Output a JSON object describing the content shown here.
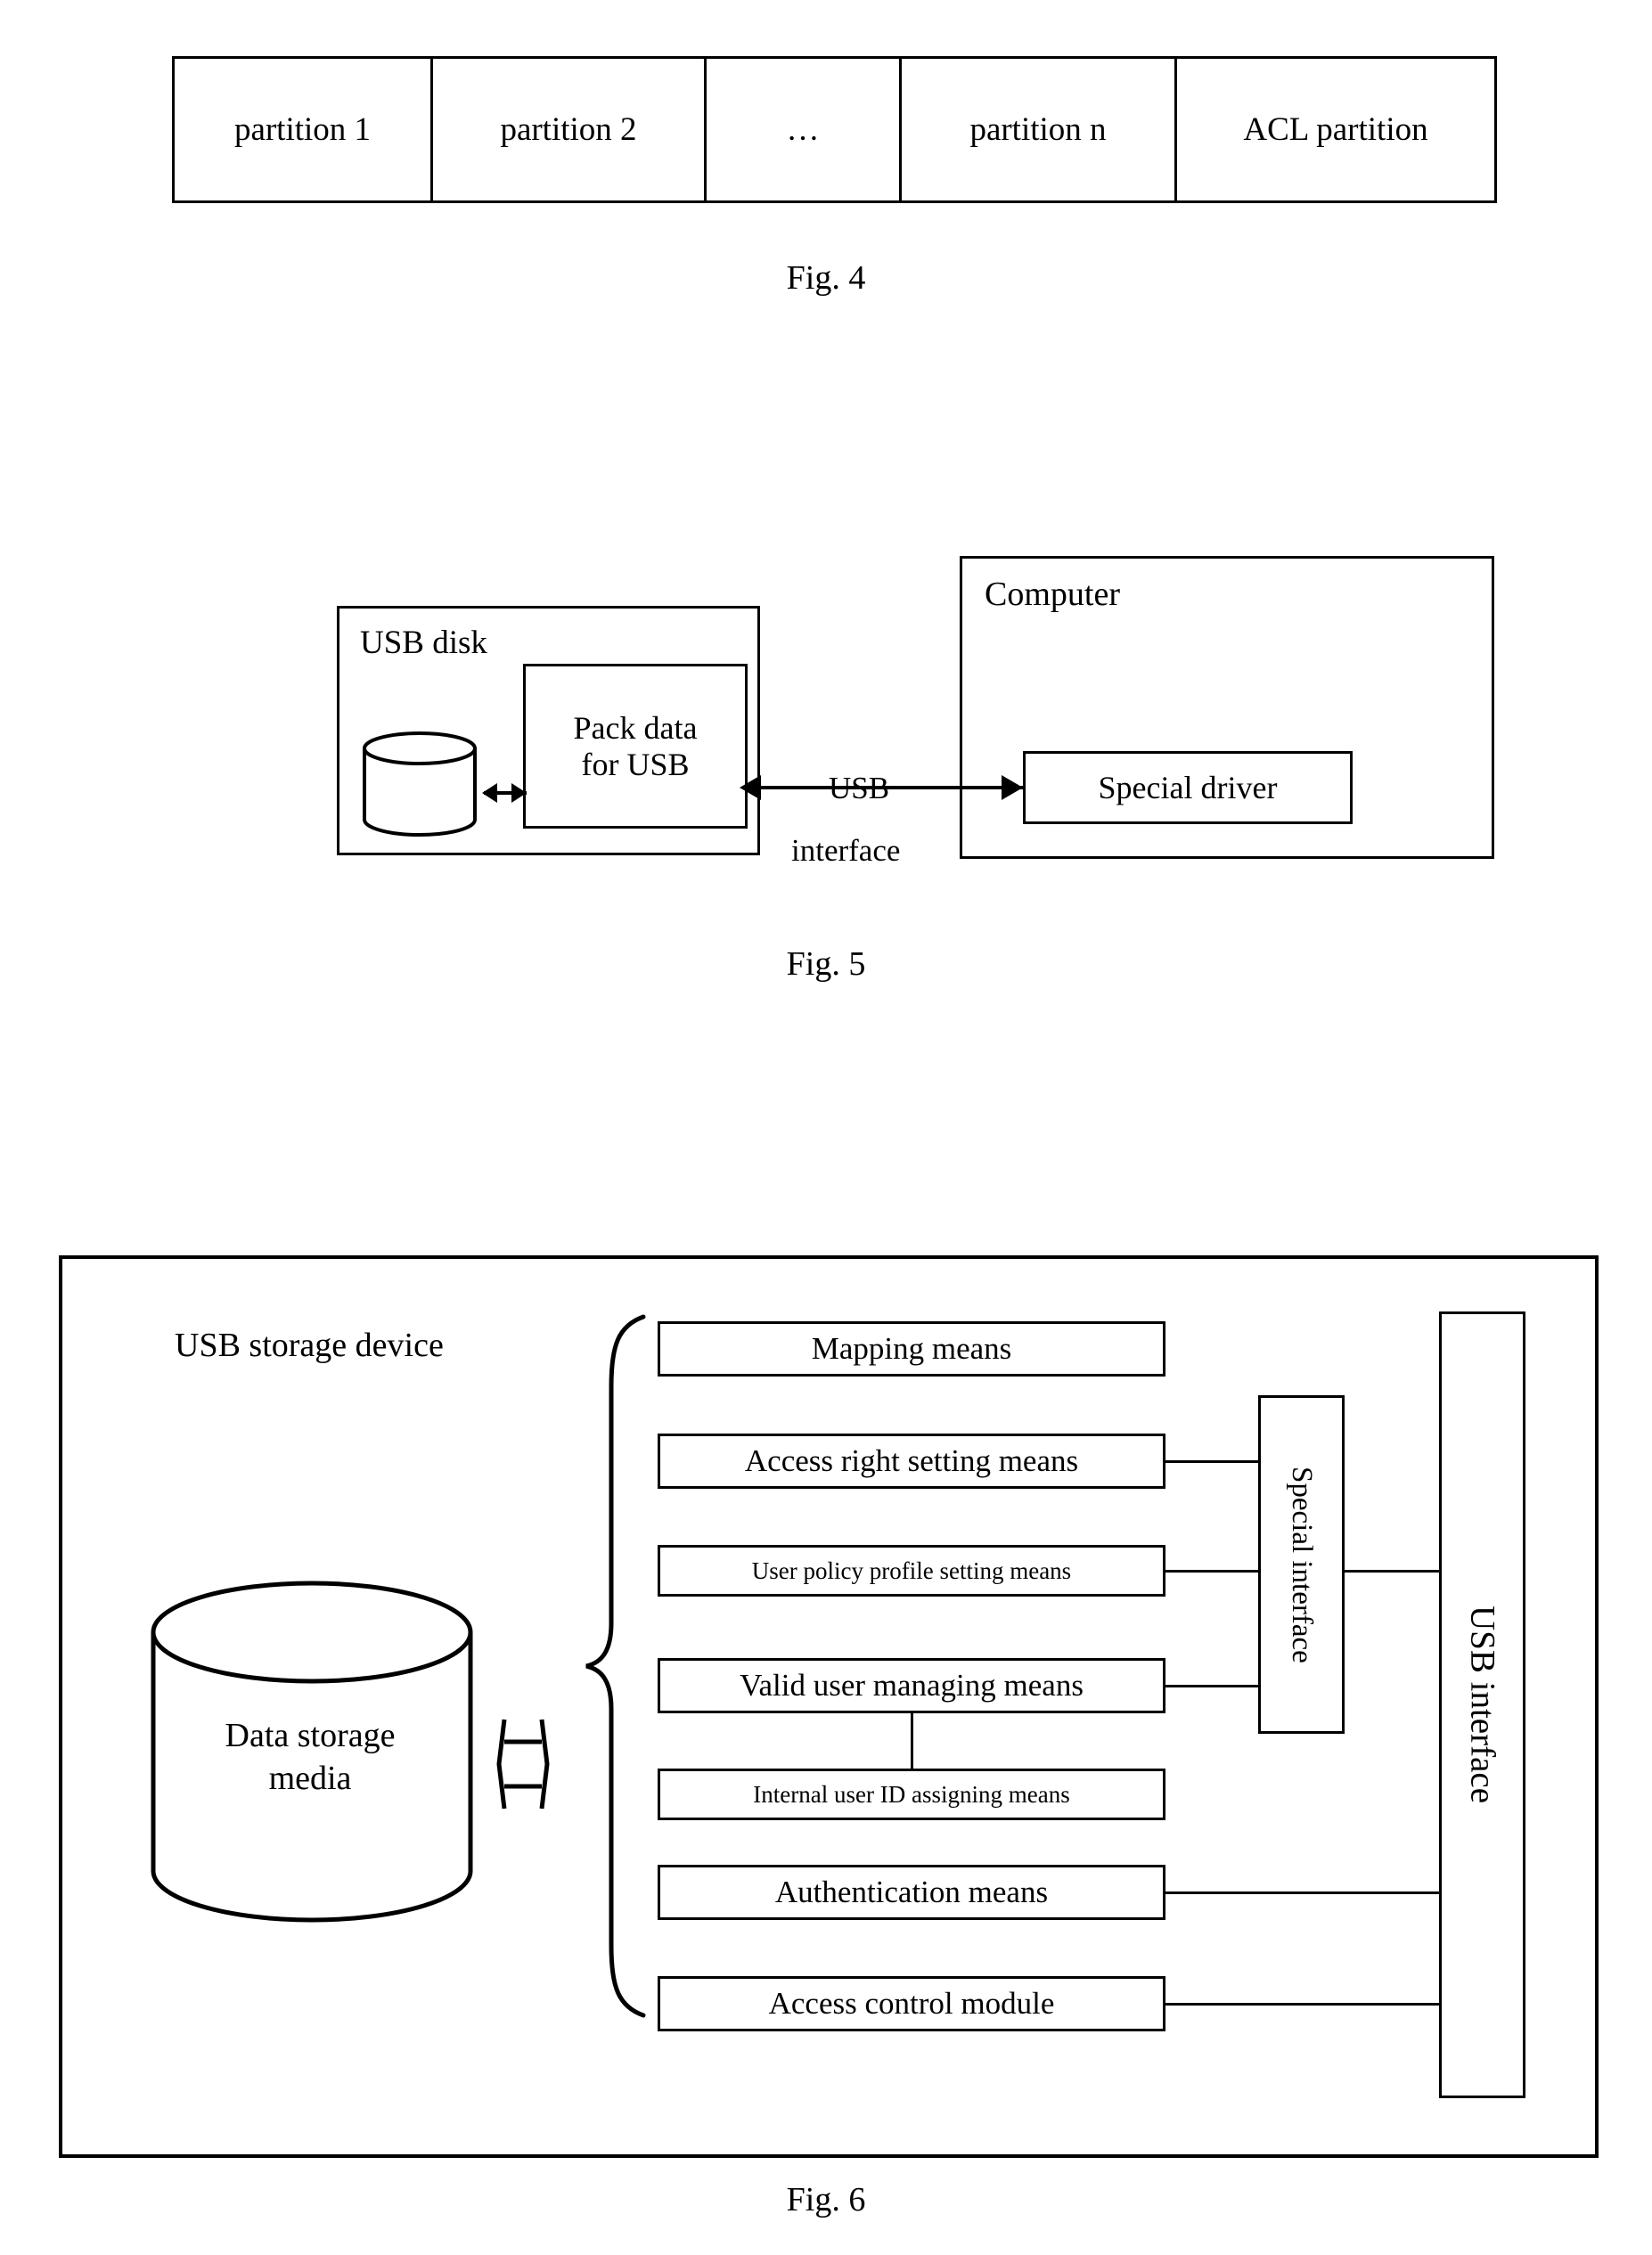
{
  "figures": {
    "fig4": {
      "caption": "Fig. 4",
      "cells": [
        {
          "label": "partition 1"
        },
        {
          "label": "partition 2"
        },
        {
          "label": "…"
        },
        {
          "label": "partition n"
        },
        {
          "label": "ACL partition"
        }
      ]
    },
    "fig5": {
      "caption": "Fig. 5",
      "usb_disk_label": "USB disk",
      "pack_data_label": "Pack data\nfor USB",
      "pack_data_line1": "Pack data",
      "pack_data_line2": "for USB",
      "computer_label": "Computer",
      "special_driver_label": "Special driver",
      "usb_interface_line1": "USB",
      "usb_interface_line2": "interface"
    },
    "fig6": {
      "caption": "Fig. 6",
      "device_label": "USB storage device",
      "storage_media_line1": "Data storage",
      "storage_media_line2": "media",
      "modules": [
        {
          "label": "Mapping means"
        },
        {
          "label": "Access right setting means"
        },
        {
          "label": "User policy profile setting means"
        },
        {
          "label": "Valid user managing means"
        },
        {
          "label": "Internal user ID assigning means"
        },
        {
          "label": "Authentication means"
        },
        {
          "label": "Access control module"
        }
      ],
      "special_interface_label": "Special interface",
      "usb_interface_label": "USB interface"
    }
  },
  "colors": {
    "ink": "#000000",
    "paper": "#ffffff"
  }
}
